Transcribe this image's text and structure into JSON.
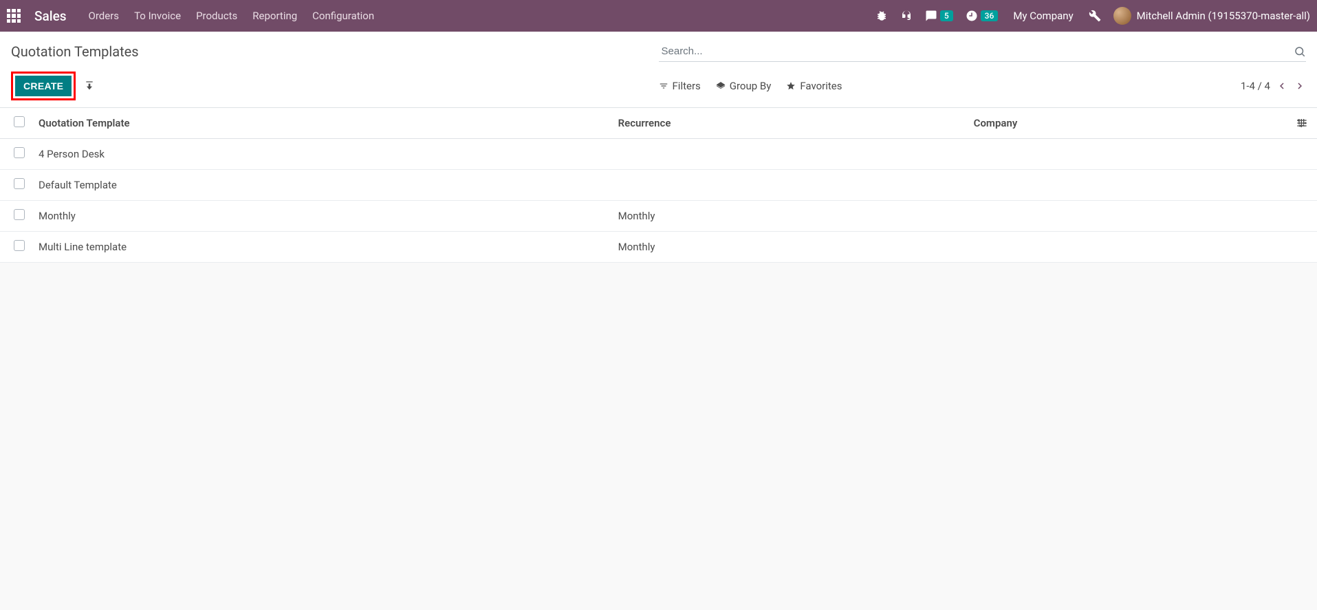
{
  "nav": {
    "brand": "Sales",
    "items": [
      "Orders",
      "To Invoice",
      "Products",
      "Reporting",
      "Configuration"
    ],
    "messaging_badge": "5",
    "activity_badge": "36",
    "company": "My Company",
    "user": "Mitchell Admin (19155370-master-all)"
  },
  "control_panel": {
    "title": "Quotation Templates",
    "create_label": "CREATE",
    "search_placeholder": "Search...",
    "filters_label": "Filters",
    "groupby_label": "Group By",
    "favorites_label": "Favorites",
    "pager_text": "1-4 / 4"
  },
  "table": {
    "columns": {
      "name": "Quotation Template",
      "recurrence": "Recurrence",
      "company": "Company"
    },
    "rows": [
      {
        "name": "4 Person Desk",
        "recurrence": "",
        "company": ""
      },
      {
        "name": "Default Template",
        "recurrence": "",
        "company": ""
      },
      {
        "name": "Monthly",
        "recurrence": "Monthly",
        "company": ""
      },
      {
        "name": "Multi Line template",
        "recurrence": "Monthly",
        "company": ""
      }
    ]
  }
}
